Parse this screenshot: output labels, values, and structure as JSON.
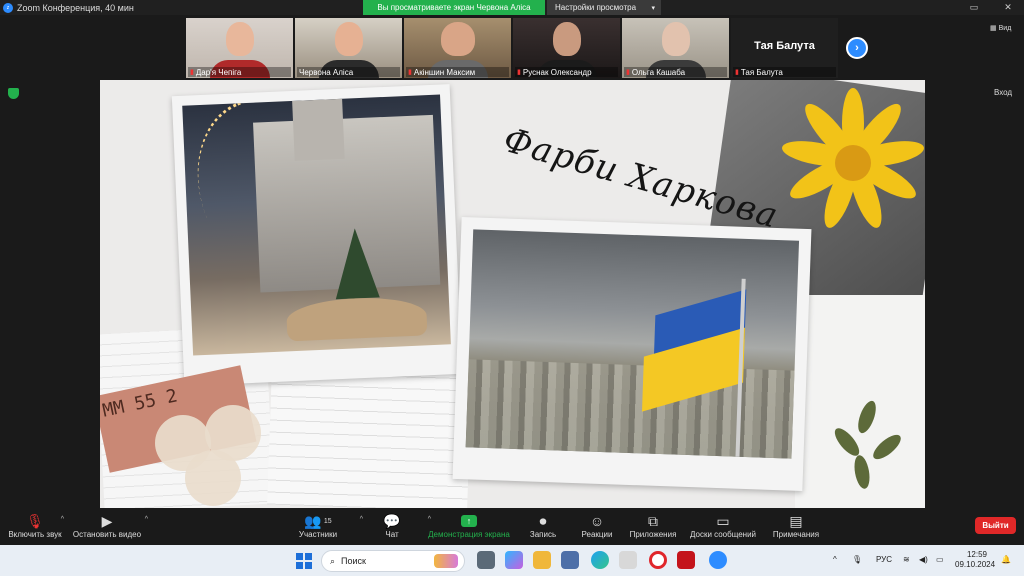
{
  "window": {
    "title": "Zoom Конференция, 40 мин",
    "share_banner": "Вы просматриваете экран Червона Аліса",
    "view_options": "Настройки просмотра"
  },
  "gallery": {
    "participants": [
      {
        "name": "Дар'я Чепіга",
        "muted": true
      },
      {
        "name": "Червона Аліса",
        "muted": false
      },
      {
        "name": "Акіншин Максим",
        "muted": true
      },
      {
        "name": "Руснак Олександр",
        "muted": true
      },
      {
        "name": "Ольга Кашаба",
        "muted": true
      },
      {
        "name": "Тая Балута",
        "muted": true,
        "display_name": "Тая Балута"
      }
    ],
    "view_label": "Вид",
    "enter_label": "Вход"
  },
  "slide": {
    "title": "Фарби Харкова",
    "ticket_text": "MM 55 2"
  },
  "toolbar": {
    "unmute": "Включить звук",
    "start_video": "Остановить видео",
    "participants": "Участники",
    "participants_count": "15",
    "chat": "Чат",
    "share": "Демонстрация экрана",
    "record": "Запись",
    "reactions": "Реакции",
    "apps": "Приложения",
    "whiteboards": "Доски сообщений",
    "notes": "Примечания",
    "leave": "Выйти"
  },
  "taskbar": {
    "search_placeholder": "Поиск",
    "lang": "РУС",
    "time": "12:59",
    "date": "09.10.2024"
  },
  "colors": {
    "zoom_blue": "#2d8cff",
    "share_green": "#23b14d",
    "leave_red": "#e02828"
  }
}
